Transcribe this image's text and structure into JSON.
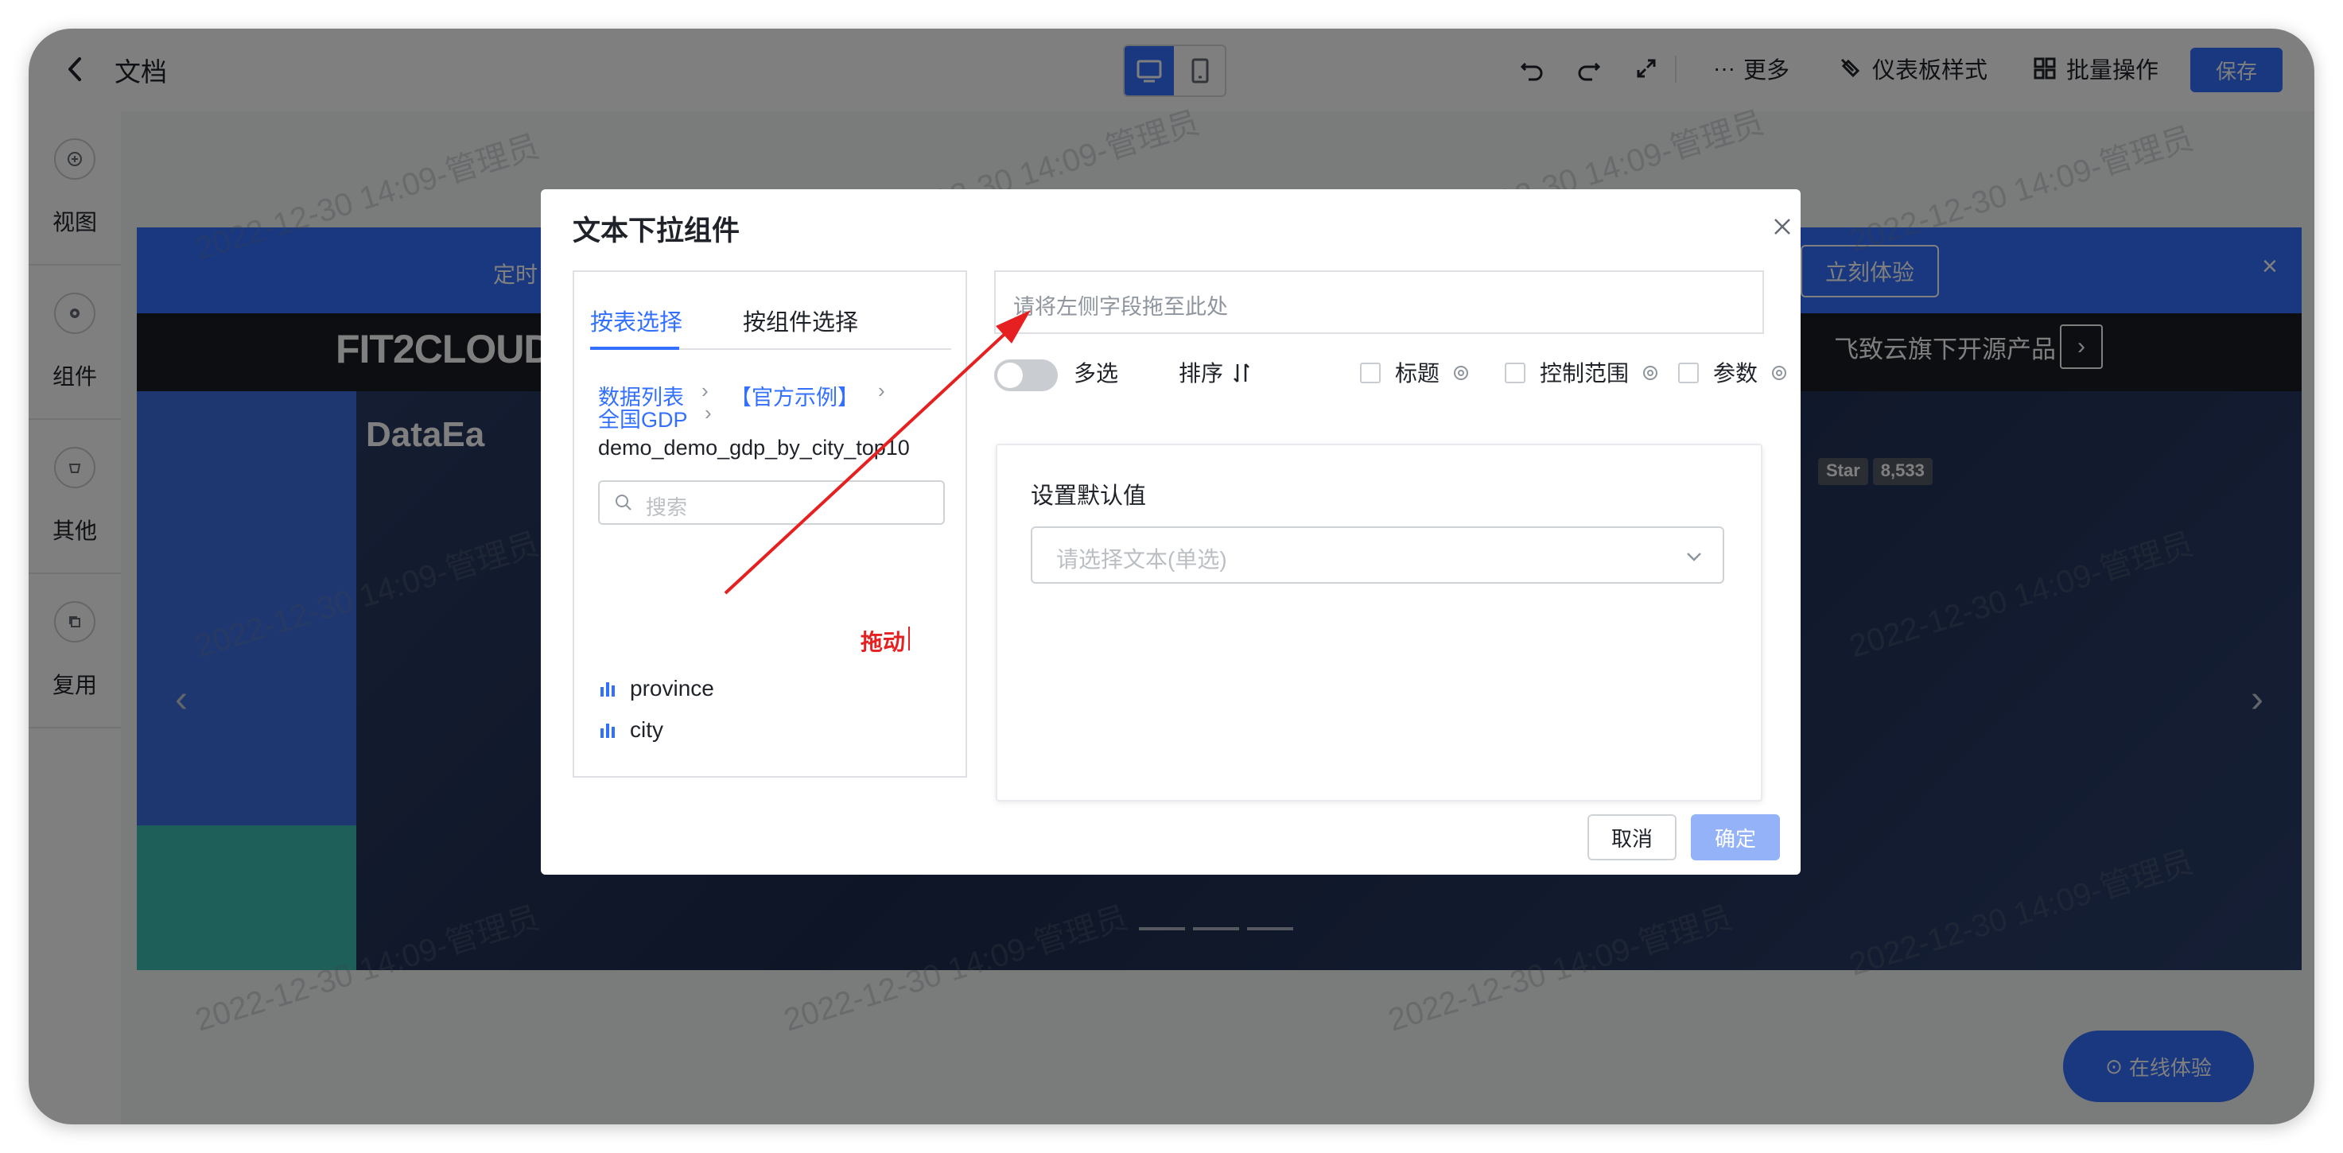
{
  "topbar": {
    "title": "文档",
    "more_label": "更多",
    "dashboard_style_label": "仪表板样式",
    "batch_label": "批量操作",
    "save_label": "保存"
  },
  "sidebar": {
    "items": [
      {
        "label": "视图",
        "icon": "plus-circle-icon"
      },
      {
        "label": "组件",
        "icon": "gear-icon"
      },
      {
        "label": "其他",
        "icon": "cup-icon"
      },
      {
        "label": "复用",
        "icon": "copy-icon"
      }
    ]
  },
  "canvas": {
    "banner_left_text": "定时",
    "banner_button": "立刻体验",
    "brand_logo": "FIT2CLOUD",
    "darkband_text": "飞致云旗下开源产品",
    "hero_logo": "DataEa",
    "star_label": "Star",
    "star_count": "8,533",
    "online_button": "在线体验",
    "watermark": "2022-12-30 14:09-管理员"
  },
  "dialog": {
    "title": "文本下拉组件",
    "tabs": [
      "按表选择",
      "按组件选择"
    ],
    "breadcrumb": [
      "数据列表",
      "【官方示例】",
      "全国GDP"
    ],
    "dataset": "demo_demo_gdp_by_city_top10",
    "search_placeholder": "搜索",
    "fields": [
      "province",
      "city"
    ],
    "drag_annotation": "拖动",
    "drop_placeholder": "请将左侧字段拖至此处",
    "multi_select_label": "多选",
    "sort_label": "排序",
    "title_label": "标题",
    "range_label": "控制范围",
    "param_label": "参数",
    "default_value_title": "设置默认值",
    "default_value_placeholder": "请选择文本(单选)",
    "cancel_label": "取消",
    "confirm_label": "确定"
  },
  "colors": {
    "accent": "#3370ff",
    "annotation": "#e62020",
    "confirm_disabled": "#94b2f7"
  }
}
